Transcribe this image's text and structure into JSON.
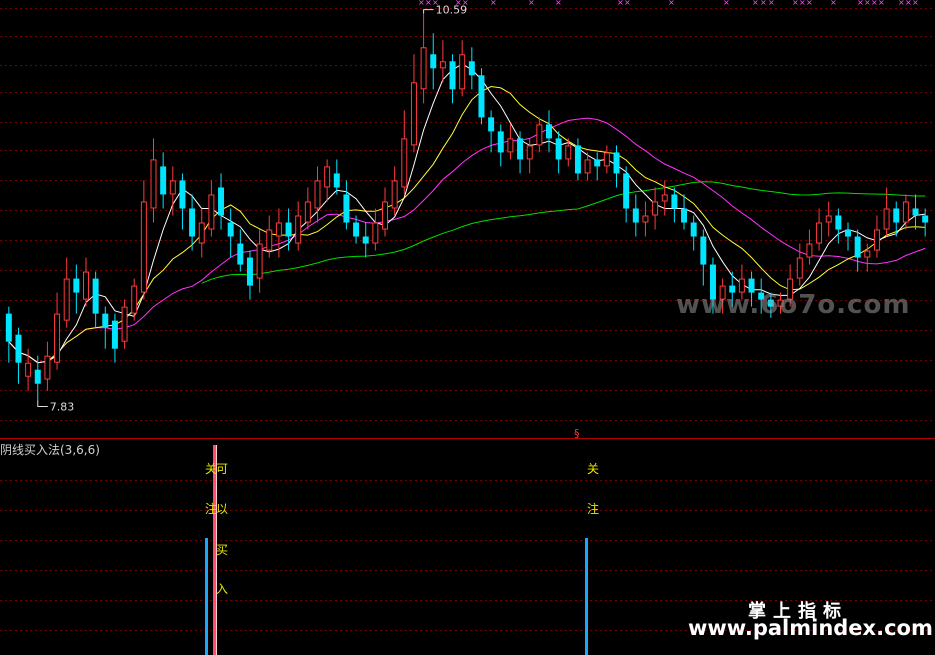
{
  "indicator": {
    "title": "阴线买入法(3,6,6)",
    "signals": [
      {
        "chars": [
          "关",
          "注"
        ]
      },
      {
        "chars": [
          "可",
          "以",
          "买",
          "入"
        ]
      },
      {
        "chars": [
          "关",
          "注"
        ]
      }
    ]
  },
  "watermarks": {
    "site": "www.6o7o.com",
    "brand": "掌上指标",
    "url": "www.palmindex.com"
  },
  "colors": {
    "background": "#000000",
    "up": "#ff3b3b",
    "down": "#00e5ff",
    "ma_white": "#ffffff",
    "ma_yellow": "#ffff33",
    "ma_magenta": "#ff33ff",
    "ma_green": "#00dd00",
    "grid": "#7a0000",
    "divider": "#b00000",
    "signal_text": "#e8e800",
    "signal_bar": "#1ea5ff"
  },
  "chart_data": {
    "type": "candlestick",
    "high_label": "10.59",
    "low_label": "7.83",
    "ylim": [
      7.62,
      10.63
    ],
    "candles": [
      [
        8.45,
        8.25,
        8.5,
        8.1
      ],
      [
        8.3,
        8.1,
        8.35,
        7.95
      ],
      [
        8.0,
        8.1,
        8.2,
        7.9
      ],
      [
        8.05,
        7.95,
        8.15,
        7.83
      ],
      [
        7.98,
        8.15,
        8.25,
        7.9
      ],
      [
        8.1,
        8.45,
        8.6,
        8.05
      ],
      [
        8.4,
        8.7,
        8.85,
        8.35
      ],
      [
        8.7,
        8.6,
        8.8,
        8.45
      ],
      [
        8.55,
        8.75,
        8.85,
        8.5
      ],
      [
        8.7,
        8.45,
        8.75,
        8.35
      ],
      [
        8.45,
        8.35,
        8.5,
        8.2
      ],
      [
        8.4,
        8.2,
        8.45,
        8.1
      ],
      [
        8.25,
        8.5,
        8.55,
        8.2
      ],
      [
        8.45,
        8.65,
        8.7,
        8.4
      ],
      [
        8.6,
        9.25,
        9.4,
        8.55
      ],
      [
        9.2,
        9.55,
        9.7,
        9.1
      ],
      [
        9.5,
        9.3,
        9.6,
        9.2
      ],
      [
        9.3,
        9.4,
        9.5,
        9.15
      ],
      [
        9.4,
        9.2,
        9.45,
        9.05
      ],
      [
        9.2,
        9.0,
        9.3,
        8.9
      ],
      [
        8.95,
        9.1,
        9.2,
        8.85
      ],
      [
        9.05,
        9.3,
        9.4,
        9.0
      ],
      [
        9.35,
        9.15,
        9.45,
        9.05
      ],
      [
        9.1,
        9.0,
        9.2,
        8.85
      ],
      [
        8.95,
        8.8,
        9.05,
        8.75
      ],
      [
        8.85,
        8.65,
        8.9,
        8.55
      ],
      [
        8.7,
        8.95,
        9.05,
        8.6
      ],
      [
        8.9,
        9.05,
        9.15,
        8.85
      ],
      [
        9.0,
        9.1,
        9.2,
        8.85
      ],
      [
        9.1,
        9.0,
        9.2,
        8.9
      ],
      [
        8.95,
        9.15,
        9.25,
        8.9
      ],
      [
        9.1,
        9.25,
        9.35,
        9.05
      ],
      [
        9.2,
        9.4,
        9.5,
        9.1
      ],
      [
        9.35,
        9.5,
        9.55,
        9.25
      ],
      [
        9.45,
        9.35,
        9.55,
        9.3
      ],
      [
        9.3,
        9.1,
        9.4,
        9.05
      ],
      [
        9.1,
        9.0,
        9.15,
        8.95
      ],
      [
        9.0,
        8.95,
        9.1,
        8.85
      ],
      [
        8.95,
        9.1,
        9.2,
        8.9
      ],
      [
        9.05,
        9.25,
        9.35,
        9.0
      ],
      [
        9.2,
        9.4,
        9.5,
        9.15
      ],
      [
        9.35,
        9.7,
        9.9,
        9.3
      ],
      [
        9.65,
        10.1,
        10.3,
        9.6
      ],
      [
        10.05,
        10.35,
        10.59,
        9.95
      ],
      [
        10.3,
        10.2,
        10.45,
        10.05
      ],
      [
        10.2,
        10.25,
        10.4,
        10.1
      ],
      [
        10.25,
        10.05,
        10.3,
        9.95
      ],
      [
        10.05,
        10.3,
        10.4,
        10.0
      ],
      [
        10.25,
        10.15,
        10.35,
        10.05
      ],
      [
        10.15,
        9.85,
        10.2,
        9.8
      ],
      [
        9.85,
        9.75,
        9.9,
        9.6
      ],
      [
        9.75,
        9.6,
        9.8,
        9.5
      ],
      [
        9.6,
        9.7,
        9.8,
        9.55
      ],
      [
        9.7,
        9.55,
        9.75,
        9.45
      ],
      [
        9.55,
        9.65,
        9.7,
        9.45
      ],
      [
        9.65,
        9.8,
        9.85,
        9.6
      ],
      [
        9.8,
        9.7,
        9.9,
        9.6
      ],
      [
        9.7,
        9.55,
        9.75,
        9.45
      ],
      [
        9.55,
        9.65,
        9.7,
        9.5
      ],
      [
        9.65,
        9.45,
        9.7,
        9.4
      ],
      [
        9.45,
        9.55,
        9.6,
        9.4
      ],
      [
        9.55,
        9.5,
        9.6,
        9.4
      ],
      [
        9.5,
        9.6,
        9.65,
        9.45
      ],
      [
        9.6,
        9.45,
        9.65,
        9.35
      ],
      [
        9.45,
        9.2,
        9.5,
        9.1
      ],
      [
        9.2,
        9.1,
        9.3,
        9.0
      ],
      [
        9.1,
        9.15,
        9.25,
        9.0
      ],
      [
        9.15,
        9.25,
        9.35,
        9.05
      ],
      [
        9.25,
        9.3,
        9.4,
        9.15
      ],
      [
        9.3,
        9.2,
        9.35,
        9.1
      ],
      [
        9.2,
        9.1,
        9.3,
        9.05
      ],
      [
        9.1,
        9.0,
        9.15,
        8.9
      ],
      [
        9.0,
        8.8,
        9.05,
        8.65
      ],
      [
        8.8,
        8.55,
        8.85,
        8.45
      ],
      [
        8.55,
        8.65,
        8.7,
        8.45
      ],
      [
        8.65,
        8.6,
        8.75,
        8.5
      ],
      [
        8.6,
        8.7,
        8.8,
        8.55
      ],
      [
        8.7,
        8.6,
        8.75,
        8.5
      ],
      [
        8.6,
        8.55,
        8.7,
        8.45
      ],
      [
        8.55,
        8.5,
        8.6,
        8.42
      ],
      [
        8.5,
        8.55,
        8.6,
        8.45
      ],
      [
        8.55,
        8.7,
        8.8,
        8.5
      ],
      [
        8.7,
        8.85,
        8.95,
        8.65
      ],
      [
        8.85,
        8.95,
        9.05,
        8.8
      ],
      [
        8.95,
        9.1,
        9.2,
        8.9
      ],
      [
        9.1,
        9.15,
        9.25,
        9.0
      ],
      [
        9.15,
        9.05,
        9.2,
        8.95
      ],
      [
        9.05,
        9.0,
        9.1,
        8.9
      ],
      [
        9.0,
        8.85,
        9.05,
        8.75
      ],
      [
        8.85,
        8.9,
        8.95,
        8.75
      ],
      [
        8.9,
        9.05,
        9.15,
        8.85
      ],
      [
        9.05,
        9.2,
        9.35,
        9.0
      ],
      [
        9.2,
        9.1,
        9.25,
        9.0
      ],
      [
        9.1,
        9.25,
        9.3,
        9.05
      ],
      [
        9.2,
        9.15,
        9.3,
        9.05
      ],
      [
        9.15,
        9.1,
        9.2,
        9.0
      ]
    ]
  }
}
